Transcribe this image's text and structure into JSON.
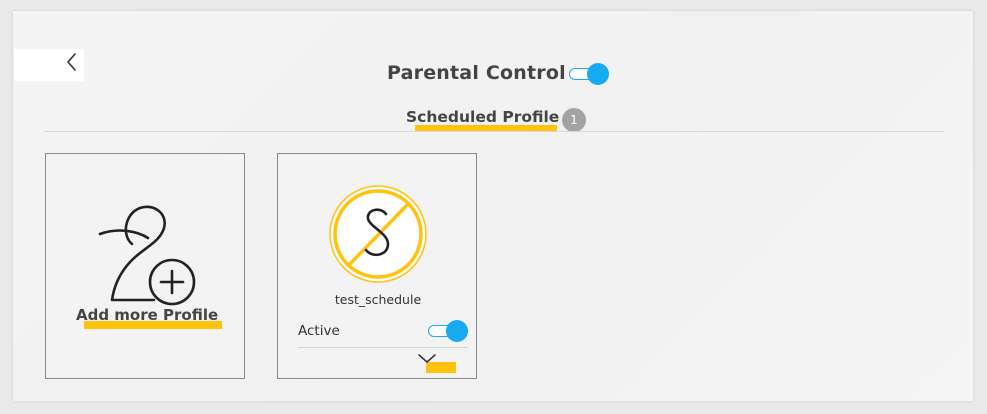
{
  "header": {
    "title": "Parental Control",
    "enabled": true
  },
  "section": {
    "title": "Scheduled Profile",
    "count": "1"
  },
  "add_card": {
    "label": "Add more Profile"
  },
  "profiles": [
    {
      "name": "test_schedule",
      "status_label": "Active",
      "active": true,
      "icon": "schedule-s-icon"
    }
  ],
  "colors": {
    "accent_blue": "#16aaf2",
    "highlight_yellow": "#ffc20e",
    "badge_gray": "#a3a3a3",
    "text_dark": "#444444"
  },
  "icons": {
    "back": "chevron-left-icon",
    "add_profile": "add-user-icon",
    "expand": "chevron-down-icon"
  }
}
